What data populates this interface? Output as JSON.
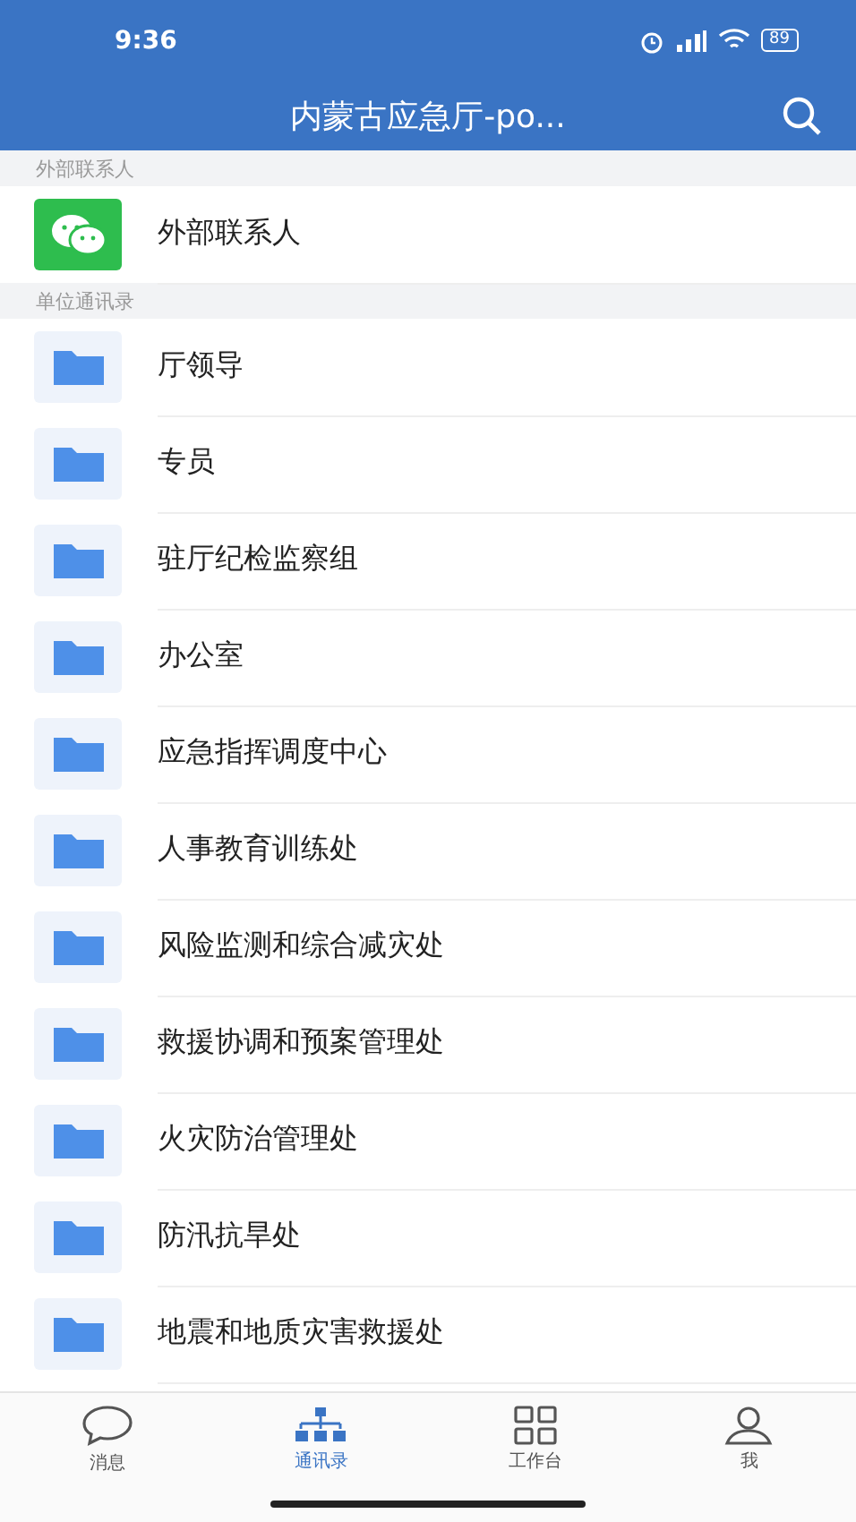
{
  "status_bar": {
    "time": "9:36",
    "battery": "89"
  },
  "header": {
    "title": "内蒙古应急厅-po..."
  },
  "sections": [
    {
      "title": "外部联系人",
      "items": [
        {
          "kind": "wechat",
          "label": "外部联系人"
        }
      ]
    },
    {
      "title": "单位通讯录",
      "items": [
        {
          "kind": "folder",
          "label": "厅领导"
        },
        {
          "kind": "folder",
          "label": "专员"
        },
        {
          "kind": "folder",
          "label": "驻厅纪检监察组"
        },
        {
          "kind": "folder",
          "label": "办公室"
        },
        {
          "kind": "folder",
          "label": "应急指挥调度中心"
        },
        {
          "kind": "folder",
          "label": "人事教育训练处"
        },
        {
          "kind": "folder",
          "label": "风险监测和综合减灾处"
        },
        {
          "kind": "folder",
          "label": "救援协调和预案管理处"
        },
        {
          "kind": "folder",
          "label": "火灾防治管理处"
        },
        {
          "kind": "folder",
          "label": "防汛抗旱处"
        },
        {
          "kind": "folder",
          "label": "地震和地质灾害救援处"
        }
      ]
    }
  ],
  "tabs": [
    {
      "kind": "chat",
      "label": "消息",
      "selected": false
    },
    {
      "kind": "org",
      "label": "通讯录",
      "selected": true
    },
    {
      "kind": "grid",
      "label": "工作台",
      "selected": false
    },
    {
      "kind": "person",
      "label": "我",
      "selected": false
    }
  ]
}
